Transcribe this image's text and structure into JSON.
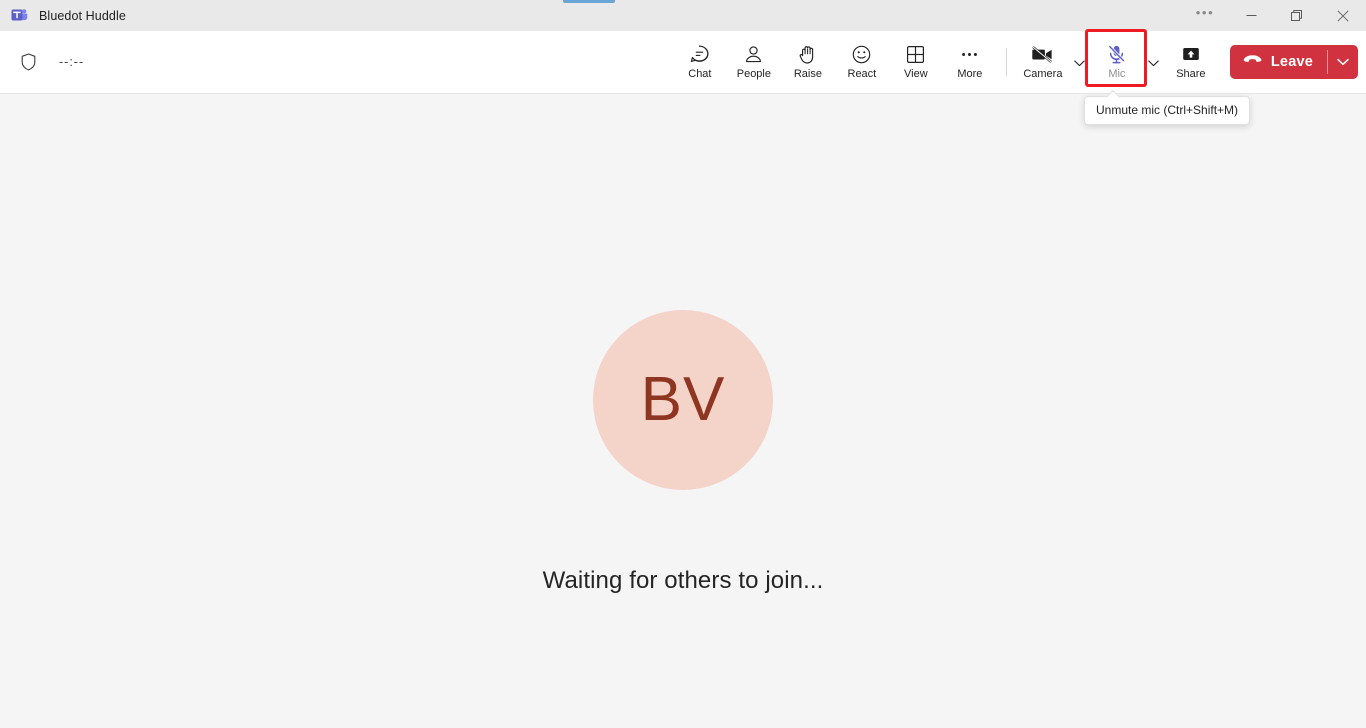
{
  "window": {
    "title": "Bluedot Huddle",
    "app_icon": "teams-logo-icon",
    "controls": {
      "more_label": "•••",
      "minimize_label": "minimize-icon",
      "maximize_label": "restore-icon",
      "close_label": "close-icon"
    }
  },
  "toolbar": {
    "shield_icon": "shield-icon",
    "timer": "--:--",
    "items": [
      {
        "label": "Chat",
        "icon": "chat-icon",
        "state": "default"
      },
      {
        "label": "People",
        "icon": "people-icon",
        "state": "default"
      },
      {
        "label": "Raise",
        "icon": "raise-hand-icon",
        "state": "default"
      },
      {
        "label": "React",
        "icon": "react-emoji-icon",
        "state": "default"
      },
      {
        "label": "View",
        "icon": "view-grid-icon",
        "state": "default"
      },
      {
        "label": "More",
        "icon": "more-ellipsis-icon",
        "state": "default"
      }
    ],
    "camera": {
      "label": "Camera",
      "icon": "camera-off-icon",
      "state": "off"
    },
    "mic": {
      "label": "Mic",
      "icon": "mic-muted-icon",
      "state": "muted",
      "highlighted": true
    },
    "share": {
      "label": "Share",
      "icon": "share-screen-icon",
      "state": "default"
    },
    "leave": {
      "label": "Leave",
      "icon": "hangup-phone-icon"
    }
  },
  "tooltip": {
    "text": "Unmute mic (Ctrl+Shift+M)"
  },
  "stage": {
    "avatar_initials": "BV",
    "status_text": "Waiting for others to join..."
  },
  "colors": {
    "titlebar_bg": "#e9e9e9",
    "toolbar_bg": "#ffffff",
    "stage_bg": "#f5f5f5",
    "avatar_bg": "#f4d3c9",
    "avatar_fg": "#8e3621",
    "leave_red": "#d0323f",
    "highlight_red": "#ee1b24",
    "mic_muted_purple": "#5b5fc7",
    "drag_accent_blue": "#6ba5d7"
  }
}
